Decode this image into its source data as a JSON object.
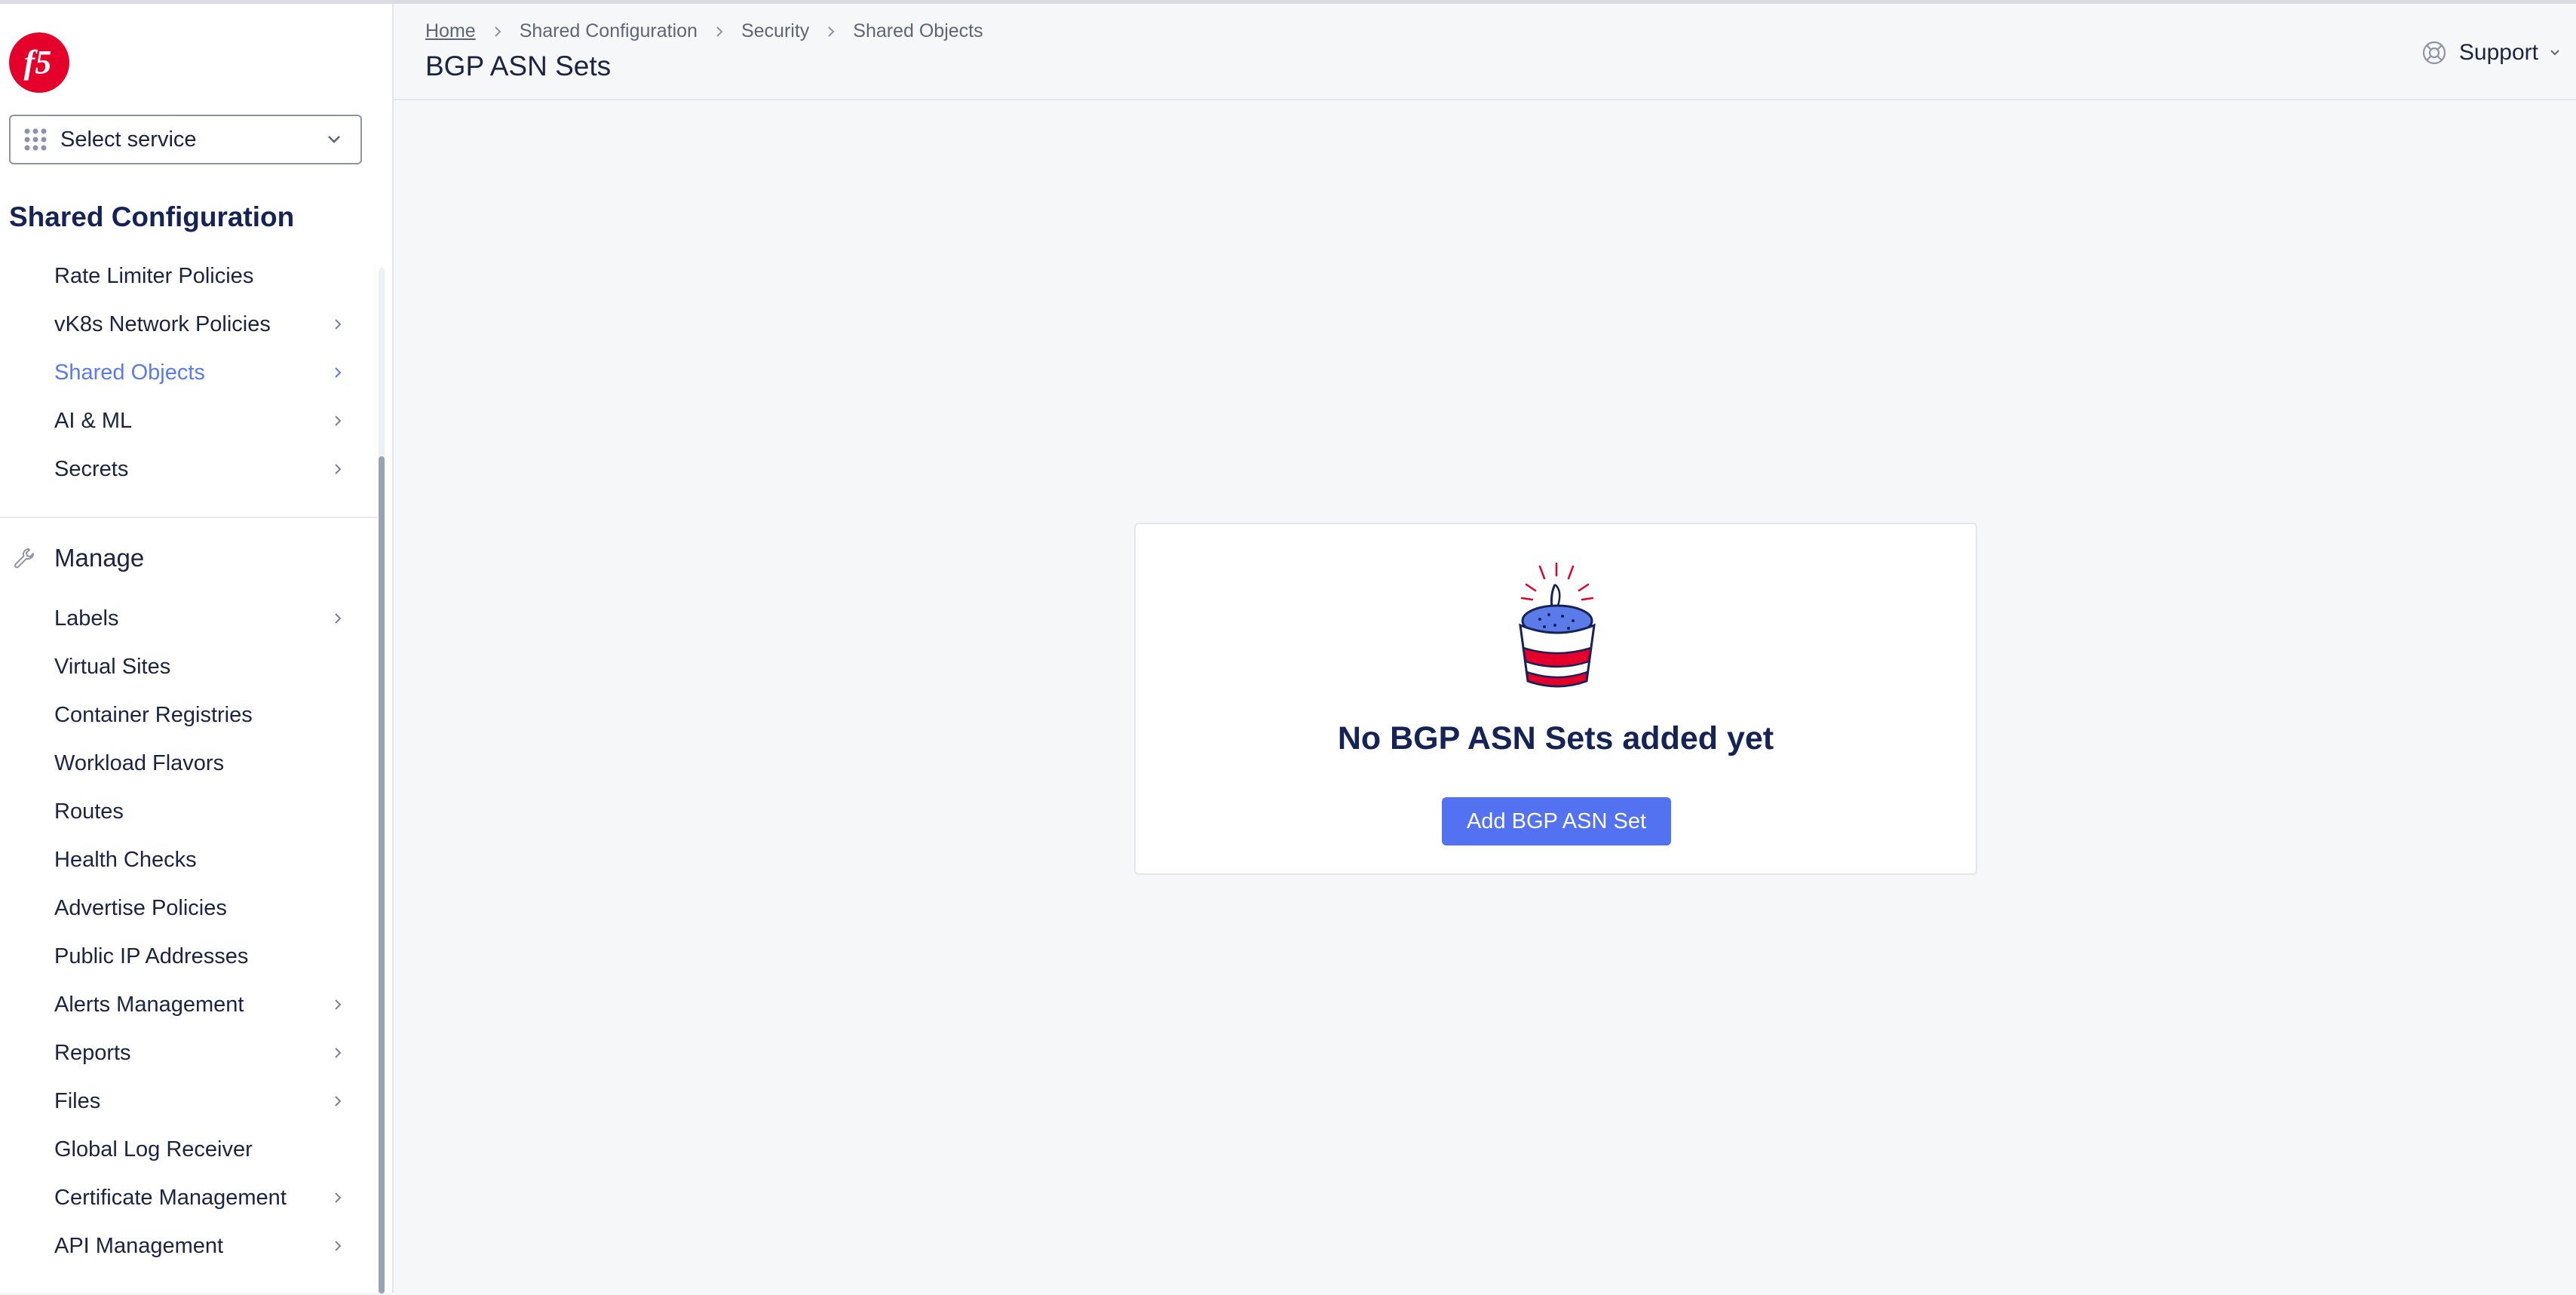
{
  "sidebar": {
    "select_service_label": "Select service",
    "section_title": "Shared Configuration",
    "items_top": [
      {
        "label": "Rate Limiter Policies",
        "has_arrow": false
      },
      {
        "label": "vK8s Network Policies",
        "has_arrow": true
      },
      {
        "label": "Shared Objects",
        "has_arrow": true,
        "active": true
      },
      {
        "label": "AI & ML",
        "has_arrow": true
      },
      {
        "label": "Secrets",
        "has_arrow": true
      }
    ],
    "manage_title": "Manage",
    "manage_items": [
      {
        "label": "Labels",
        "has_arrow": true
      },
      {
        "label": "Virtual Sites",
        "has_arrow": false
      },
      {
        "label": "Container Registries",
        "has_arrow": false
      },
      {
        "label": "Workload Flavors",
        "has_arrow": false
      },
      {
        "label": "Routes",
        "has_arrow": false
      },
      {
        "label": "Health Checks",
        "has_arrow": false
      },
      {
        "label": "Advertise Policies",
        "has_arrow": false
      },
      {
        "label": "Public IP Addresses",
        "has_arrow": false
      },
      {
        "label": "Alerts Management",
        "has_arrow": true
      },
      {
        "label": "Reports",
        "has_arrow": true
      },
      {
        "label": "Files",
        "has_arrow": true
      },
      {
        "label": "Global Log Receiver",
        "has_arrow": false
      },
      {
        "label": "Certificate Management",
        "has_arrow": true
      },
      {
        "label": "API Management",
        "has_arrow": true
      }
    ]
  },
  "header": {
    "breadcrumb": [
      "Home",
      "Shared Configuration",
      "Security",
      "Shared Objects"
    ],
    "title": "BGP ASN Sets",
    "support_label": "Support"
  },
  "empty_state": {
    "title": "No BGP ASN Sets added yet",
    "button_label": "Add BGP ASN Set"
  },
  "colors": {
    "accent": "#5272f2",
    "active_nav": "#5a7be8",
    "brand_red": "#e4002b",
    "title_navy": "#152356"
  }
}
